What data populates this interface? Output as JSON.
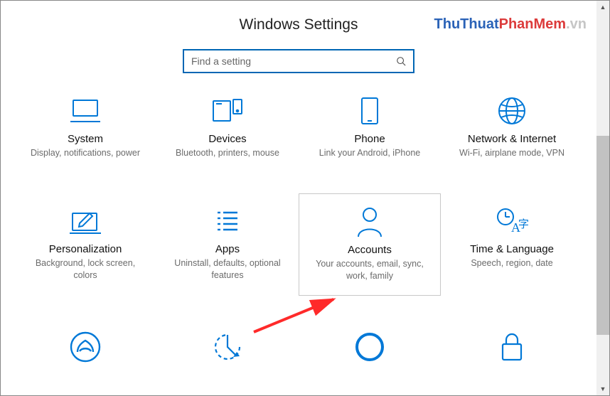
{
  "header": {
    "title": "Windows Settings"
  },
  "watermark": {
    "part_blue": "ThuThuat",
    "part_red": "PhanMem",
    "part_gray": ".vn"
  },
  "search": {
    "placeholder": "Find a setting",
    "value": ""
  },
  "tiles": {
    "system": {
      "label": "System",
      "desc": "Display, notifications, power"
    },
    "devices": {
      "label": "Devices",
      "desc": "Bluetooth, printers, mouse"
    },
    "phone": {
      "label": "Phone",
      "desc": "Link your Android, iPhone"
    },
    "network": {
      "label": "Network & Internet",
      "desc": "Wi-Fi, airplane mode, VPN"
    },
    "personal": {
      "label": "Personalization",
      "desc": "Background, lock screen, colors"
    },
    "apps": {
      "label": "Apps",
      "desc": "Uninstall, defaults, optional features"
    },
    "accounts": {
      "label": "Accounts",
      "desc": "Your accounts, email, sync, work, family"
    },
    "time": {
      "label": "Time & Language",
      "desc": "Speech, region, date"
    },
    "gaming": {
      "label": "",
      "desc": ""
    },
    "ease": {
      "label": "",
      "desc": ""
    },
    "cortana": {
      "label": "",
      "desc": ""
    },
    "privacy": {
      "label": "",
      "desc": ""
    }
  },
  "colors": {
    "accent": "#0078d7",
    "highlight_border": "#c8c8c8",
    "arrow": "#ff2a2a"
  }
}
